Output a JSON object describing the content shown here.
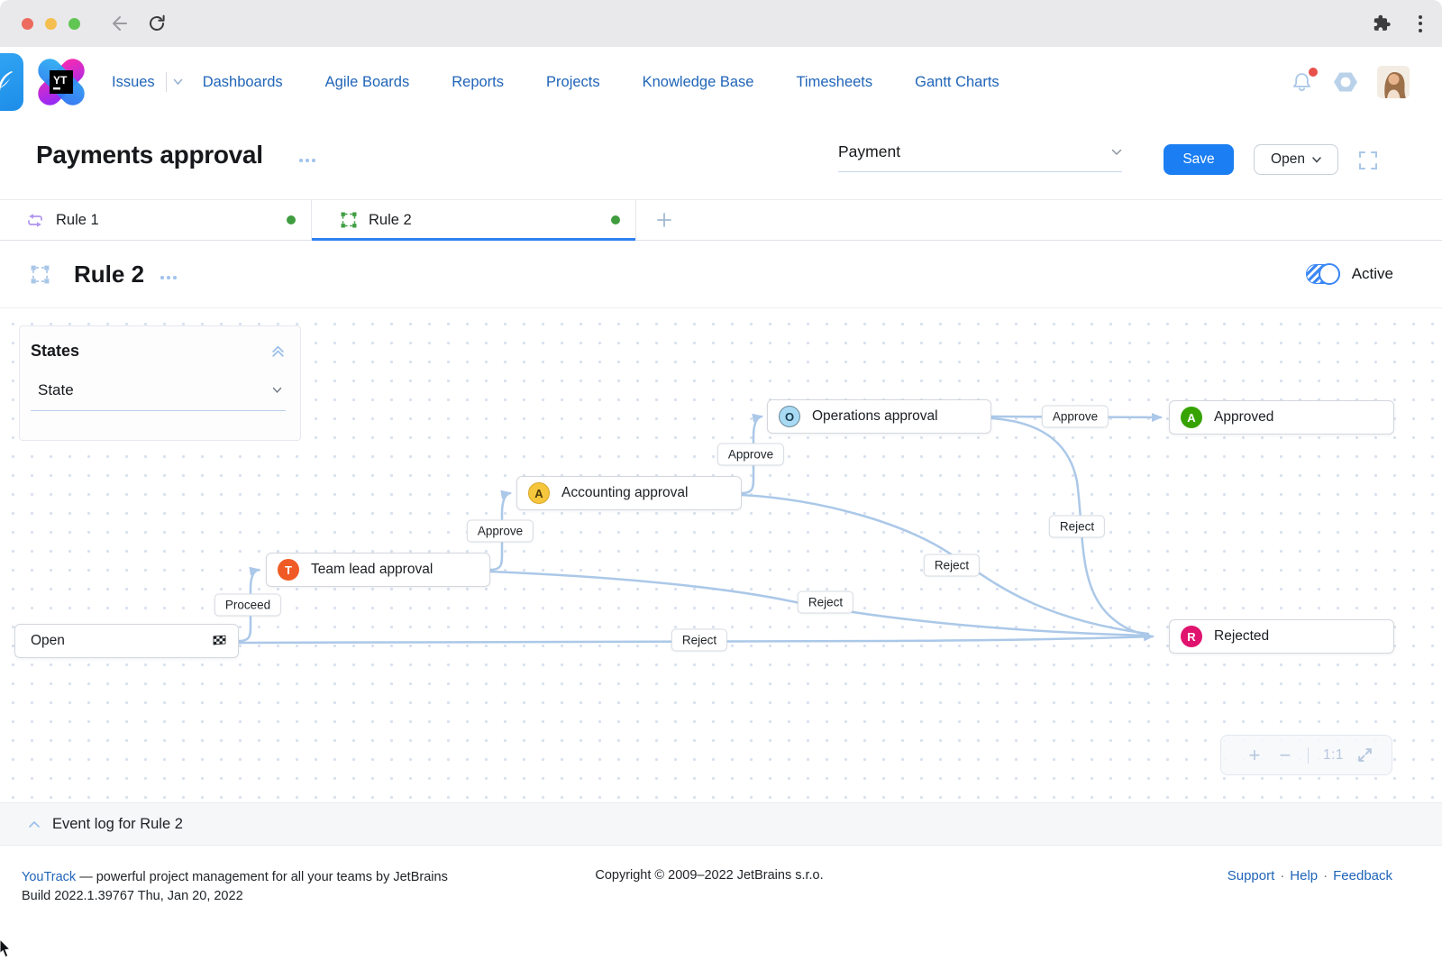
{
  "nav": {
    "items": [
      "Issues",
      "Dashboards",
      "Agile Boards",
      "Reports",
      "Projects",
      "Knowledge Base",
      "Timesheets",
      "Gantt Charts"
    ]
  },
  "header": {
    "title": "Payments approval",
    "project_value": "Payment",
    "save_label": "Save",
    "open_label": "Open"
  },
  "tabs": {
    "rule1_label": "Rule 1",
    "rule2_label": "Rule 2"
  },
  "rule_section": {
    "title": "Rule 2",
    "status_label": "Active"
  },
  "states_panel": {
    "title": "States",
    "select_value": "State"
  },
  "diagram": {
    "nodes": [
      {
        "badge": "O",
        "label": "Operations approval",
        "badge_color": "#a8daf4"
      },
      {
        "badge": "A",
        "label": "Accounting approval",
        "badge_color": "#f6c63d"
      },
      {
        "badge": "T",
        "label": "Team lead approval",
        "badge_color": "#f05b25"
      },
      {
        "badge": "A",
        "label": "Approved",
        "badge_color": "#36a302"
      },
      {
        "badge": "R",
        "label": "Rejected",
        "badge_color": "#e0136f"
      },
      {
        "label": "Open"
      }
    ],
    "edge_labels": [
      {
        "text": "Proceed"
      },
      {
        "text": "Approve"
      },
      {
        "text": "Approve"
      },
      {
        "text": "Approve"
      },
      {
        "text": "Reject"
      },
      {
        "text": "Reject"
      },
      {
        "text": "Reject"
      },
      {
        "text": "Reject"
      }
    ]
  },
  "zoom_controls": {
    "zoom_in": "+",
    "zoom_out": "−",
    "ratio": "1:1"
  },
  "event_log": {
    "label": "Event log for Rule 2"
  },
  "footer": {
    "product_link": "YouTrack",
    "tagline": " — powerful project management for all your teams by JetBrains",
    "build": "Build 2022.1.39767 Thu, Jan 20, 2022",
    "copyright": "Copyright © 2009–2022 JetBrains s.r.o.",
    "separator": "·",
    "links": [
      "Support",
      "Help",
      "Feedback"
    ]
  },
  "colors": {
    "accent_blue": "#1b7ef2",
    "edge_blue": "#abc8e8",
    "active_green": "#3f9c3f",
    "notification_red": "#e8504c"
  }
}
